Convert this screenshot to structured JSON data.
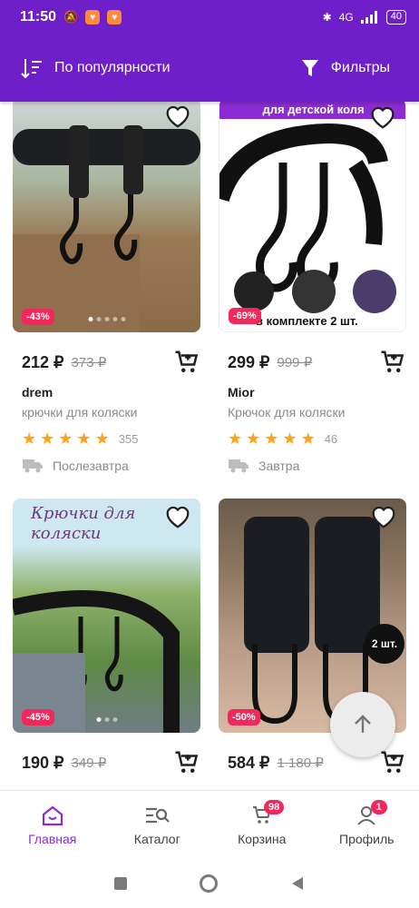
{
  "status": {
    "time": "11:50",
    "network": "4G",
    "battery": "40"
  },
  "toolbar": {
    "sort_label": "По популярности",
    "filter_label": "Фильтры"
  },
  "colors": {
    "brand": "#6e1fc9",
    "accent": "#8b2bd4",
    "discount": "#f2285c",
    "star": "#ffa312"
  },
  "products": [
    {
      "price": "212 ₽",
      "old_price": "373 ₽",
      "discount": "-43%",
      "brand": "drem",
      "name": "крючки для коляски",
      "rating_count": "355",
      "delivery": "Послезавтра",
      "image_text": ""
    },
    {
      "price": "299 ₽",
      "old_price": "999 ₽",
      "discount": "-69%",
      "brand": "Mior",
      "name": "Крючок для коляски",
      "rating_count": "46",
      "delivery": "Завтра",
      "image_text": "для детской коля",
      "image_text2": "в комплекте 2 шт."
    },
    {
      "price": "190 ₽",
      "old_price": "349 ₽",
      "discount": "-45%",
      "image_text": "Крючки для коляски"
    },
    {
      "price": "584 ₽",
      "old_price": "1 180 ₽",
      "discount": "-50%",
      "image_text": "2 шт."
    }
  ],
  "nav": [
    {
      "label": "Главная",
      "icon": "home-icon"
    },
    {
      "label": "Каталог",
      "icon": "catalog-icon"
    },
    {
      "label": "Корзина",
      "icon": "cart-icon",
      "badge": "98"
    },
    {
      "label": "Профиль",
      "icon": "profile-icon",
      "badge": "1"
    }
  ]
}
